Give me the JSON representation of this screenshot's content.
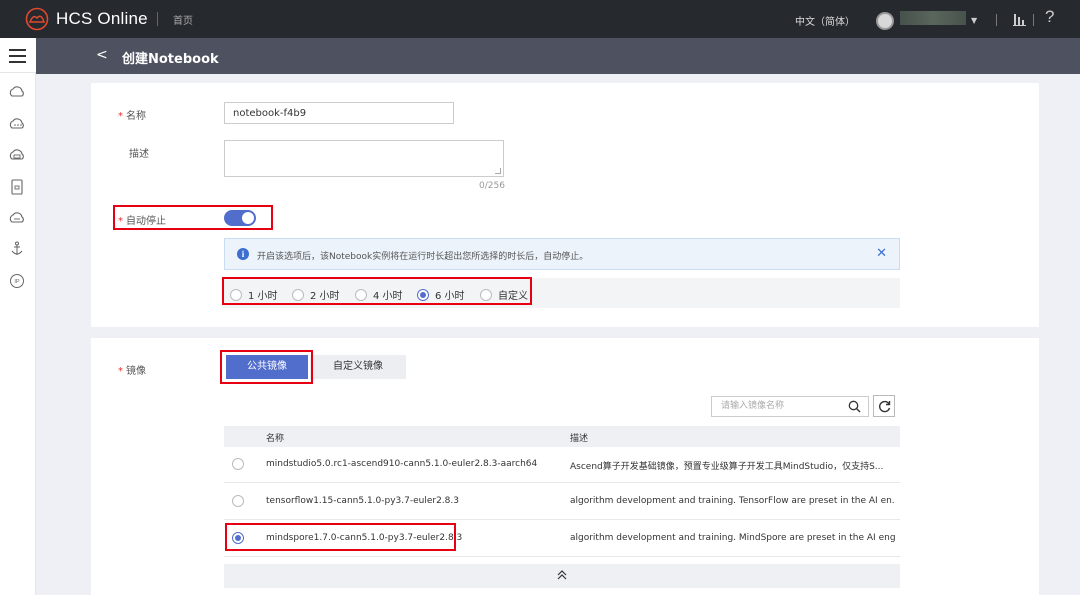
{
  "header": {
    "brand": "HCS Online",
    "home": "首页",
    "language": "中文（简体）",
    "help": "?"
  },
  "titlebar": {
    "back": "<",
    "title": "创建Notebook"
  },
  "form": {
    "name_label": "名称",
    "name_value": "notebook-f4b9",
    "desc_label": "描述",
    "desc_counter": "0/256",
    "auto_stop_label": "自动停止",
    "auto_stop_on": true,
    "info_text": "开启该选项后，该Notebook实例将在运行时长超出您所选择的时长后，自动停止。",
    "durations": [
      {
        "label": "1 小时",
        "selected": false
      },
      {
        "label": "2 小时",
        "selected": false
      },
      {
        "label": "4 小时",
        "selected": false
      },
      {
        "label": "6 小时",
        "selected": true
      },
      {
        "label": "自定义",
        "selected": false
      }
    ]
  },
  "image": {
    "label": "镜像",
    "tabs": [
      "公共镜像",
      "自定义镜像"
    ],
    "active_tab": "公共镜像",
    "search_placeholder": "请输入镜像名称",
    "columns": [
      "名称",
      "描述"
    ],
    "rows": [
      {
        "name": "mindstudio5.0.rc1-ascend910-cann5.1.0-euler2.8.3-aarch64",
        "desc": "Ascend算子开发基础镜像，预置专业级算子开发工具MindStudio，仅支持S...",
        "selected": false
      },
      {
        "name": "tensorflow1.15-cann5.1.0-py3.7-euler2.8.3",
        "desc": "algorithm development and training. TensorFlow are preset in the AI en...",
        "selected": false
      },
      {
        "name": "mindspore1.7.0-cann5.1.0-py3.7-euler2.8.3",
        "desc": "algorithm development and training. MindSpore are preset in the AI eng...",
        "selected": true
      }
    ]
  },
  "colors": {
    "accent": "#526ecc",
    "topbar": "#26292e",
    "titlebar": "#4e5260",
    "highlight": "#e60012",
    "required": "#e5322f"
  }
}
